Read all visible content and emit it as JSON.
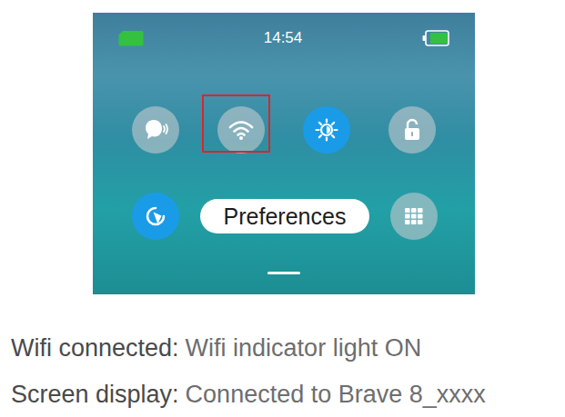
{
  "screen": {
    "time": "14:54",
    "battery": {
      "level": 0.85
    },
    "quick_settings": [
      [
        {
          "kind": "voice",
          "active": false,
          "highlighted": false
        },
        {
          "kind": "wifi",
          "active": false,
          "highlighted": true
        },
        {
          "kind": "brightness",
          "active": true,
          "highlighted": false
        },
        {
          "kind": "lock",
          "active": false,
          "highlighted": false
        }
      ],
      [
        {
          "kind": "rotate",
          "active": true,
          "highlighted": false
        },
        {
          "kind": "label",
          "text": "Preferences"
        },
        {
          "kind": "grid",
          "active": false,
          "highlighted": false
        }
      ]
    ]
  },
  "notes": [
    {
      "label": "Wifi connected:",
      "value": "Wifi indicator light ON"
    },
    {
      "label": "Screen display:",
      "value": "Connected to Brave 8_xxxx"
    }
  ]
}
